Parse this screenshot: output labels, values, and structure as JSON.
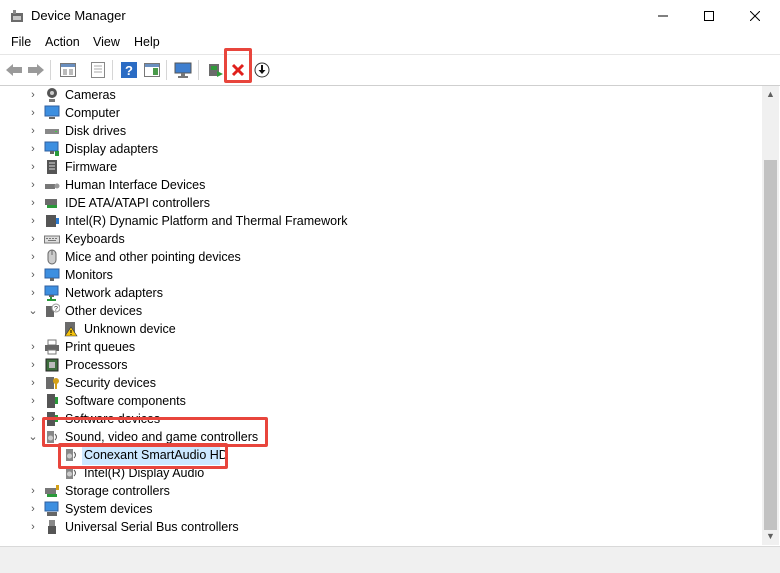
{
  "window": {
    "title": "Device Manager"
  },
  "menu": [
    "File",
    "Action",
    "View",
    "Help"
  ],
  "toolbar": {
    "buttons": [
      "back-arrow-icon",
      "forward-arrow-icon",
      "properties-icon",
      "show-hidden-icon",
      "help-icon",
      "action-pane-icon",
      "monitor-icon",
      "update-driver-icon",
      "uninstall-icon",
      "scan-icon"
    ]
  },
  "tree": {
    "items": [
      {
        "label": "Cameras",
        "icon": "camera-icon",
        "expanded": false
      },
      {
        "label": "Computer",
        "icon": "computer-icon",
        "expanded": false
      },
      {
        "label": "Disk drives",
        "icon": "disk-icon",
        "expanded": false
      },
      {
        "label": "Display adapters",
        "icon": "display-adapter-icon",
        "expanded": false
      },
      {
        "label": "Firmware",
        "icon": "firmware-icon",
        "expanded": false
      },
      {
        "label": "Human Interface Devices",
        "icon": "hid-icon",
        "expanded": false
      },
      {
        "label": "IDE ATA/ATAPI controllers",
        "icon": "ide-icon",
        "expanded": false
      },
      {
        "label": "Intel(R) Dynamic Platform and Thermal Framework",
        "icon": "chip-icon",
        "expanded": false
      },
      {
        "label": "Keyboards",
        "icon": "keyboard-icon",
        "expanded": false
      },
      {
        "label": "Mice and other pointing devices",
        "icon": "mouse-icon",
        "expanded": false
      },
      {
        "label": "Monitors",
        "icon": "monitor-icon",
        "expanded": false
      },
      {
        "label": "Network adapters",
        "icon": "network-icon",
        "expanded": false
      },
      {
        "label": "Other devices",
        "icon": "other-devices-icon",
        "expanded": true
      },
      {
        "label": "Unknown device",
        "icon": "warning-device-icon",
        "child": true
      },
      {
        "label": "Print queues",
        "icon": "printer-icon",
        "expanded": false
      },
      {
        "label": "Processors",
        "icon": "processor-icon",
        "expanded": false
      },
      {
        "label": "Security devices",
        "icon": "security-icon",
        "expanded": false
      },
      {
        "label": "Software components",
        "icon": "software-icon",
        "expanded": false
      },
      {
        "label": "Software devices",
        "icon": "software-icon",
        "expanded": false
      },
      {
        "label": "Sound, video and game controllers",
        "icon": "speaker-icon",
        "expanded": true
      },
      {
        "label": "Conexant SmartAudio HD",
        "icon": "speaker-icon",
        "child": true,
        "selected": true
      },
      {
        "label": "Intel(R) Display Audio",
        "icon": "speaker-icon",
        "child": true
      },
      {
        "label": "Storage controllers",
        "icon": "storage-icon",
        "expanded": false
      },
      {
        "label": "System devices",
        "icon": "system-icon",
        "expanded": false
      },
      {
        "label": "Universal Serial Bus controllers",
        "icon": "usb-icon",
        "expanded": false
      }
    ]
  },
  "colors": {
    "highlight": "#e8453c",
    "selection": "#cce8ff",
    "accent_blue": "#1e73be"
  }
}
